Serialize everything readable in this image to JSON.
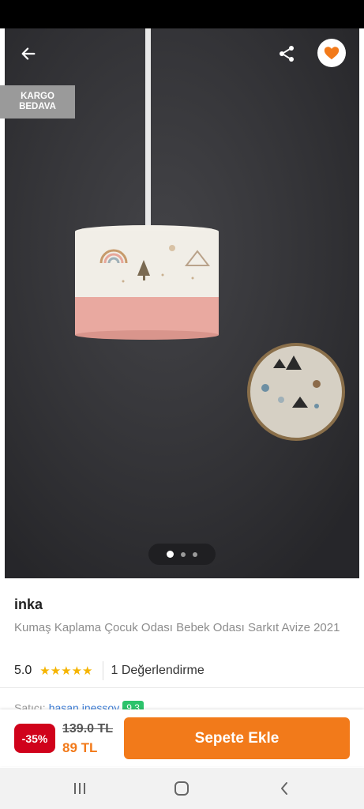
{
  "header": {
    "back_icon": "arrow-left-icon",
    "share_icon": "share-icon",
    "favorite_icon": "heart-icon"
  },
  "badge": {
    "line1": "KARGO",
    "line2": "BEDAVA"
  },
  "gallery": {
    "total_images": 3,
    "active_index": 0
  },
  "product": {
    "seller": "inka",
    "title": "Kumaş Kaplama Çocuk Odası Bebek Odası Sarkıt Avize 2021",
    "rating": "5.0",
    "stars": "★★★★★",
    "review_count": "1 Değerlendirme"
  },
  "seller_info": {
    "label": "Satıcı:",
    "name": "hasan inessoy",
    "score": "9.3"
  },
  "purchase": {
    "discount": "-35%",
    "old_price": "139.0 TL",
    "new_price": "89 TL",
    "add_to_cart": "Sepete Ekle"
  },
  "colors": {
    "accent": "#f27a1a",
    "discount": "#d0021b",
    "star": "#f5b400"
  }
}
